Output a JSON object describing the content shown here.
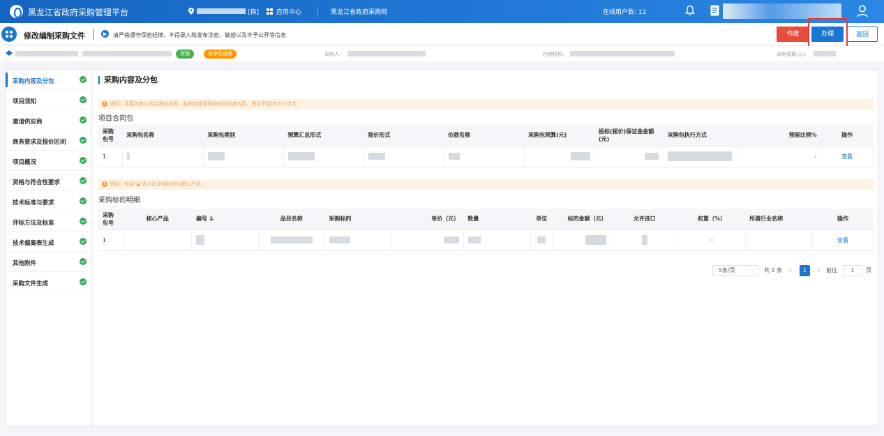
{
  "header": {
    "app_title": "黑龙江省政府采购管理平台",
    "location_suffix": "[换]",
    "app_center": "应用中心",
    "site_link": "黑龙江省政府采购网",
    "online_users": "在线用户数: 12"
  },
  "subheader": {
    "page_title": "修改编制采购文件",
    "notice": "请严格遵守保密纪律，不得录入和发布涉密、敏感以及不予公开等信息",
    "buttons": {
      "void": "作废",
      "handle": "办理",
      "back": "返回"
    }
  },
  "info": {
    "tag_goods": "货物",
    "tag_method": "竞争性磋商",
    "purchaser_label": "采购人:",
    "agency_label": "代理机构:",
    "budget_label": "采购预算(元):"
  },
  "sidebar": {
    "items": [
      {
        "label": "采购内容及分包"
      },
      {
        "label": "项目须知"
      },
      {
        "label": "邀请供应商"
      },
      {
        "label": "商务要求及报价区间"
      },
      {
        "label": "项目概况"
      },
      {
        "label": "资格与符合性要求"
      },
      {
        "label": "技术标准与要求"
      },
      {
        "label": "评标方法及标准"
      },
      {
        "label": "技术偏离表生成"
      },
      {
        "label": "其他附件"
      },
      {
        "label": "采购文件生成"
      }
    ]
  },
  "main": {
    "section_title": "采购内容及分包",
    "hint1": "说明：请更改默认的合同包名称，名称应体现采购的目的或内容，建议不超过10个汉字",
    "table1_title": "项目合同包",
    "table1": {
      "headers": [
        "采购包号",
        "采购包名称",
        "采购包类别",
        "预算汇总形式",
        "报价形式",
        "价款名称",
        "采购包预算(元)",
        "投标(报价)保证金金额(元)",
        "采购包执行方式",
        "预留比例%",
        "操作"
      ],
      "row": {
        "no": "1",
        "reserve": "-",
        "action": "查看"
      }
    },
    "hint2": "说明：包括\"▲\"表示此采购标的为核心产品",
    "table2_title": "采购标的明细",
    "table2": {
      "headers": [
        "采购包号",
        "核心产品",
        "编号 ≑",
        "品目名称",
        "采购标的",
        "单价（元）",
        "数量",
        "单位",
        "标的金额（元）",
        "允许进口",
        "权重（%）",
        "所属行业名称",
        "操作"
      ],
      "row": {
        "no": "1",
        "action": "查看"
      }
    },
    "pager": {
      "page_size": "5条/页",
      "total": "共 1 条",
      "prev": "<",
      "current": "1",
      "next": ">",
      "goto": "前往",
      "goto_value": "1",
      "page_unit": "页"
    }
  },
  "colors": {
    "primary": "#1976d2",
    "danger": "#e74c3c",
    "success": "#2eaa53",
    "warning": "#ff9800",
    "hint_bg": "#fdf1e4"
  }
}
